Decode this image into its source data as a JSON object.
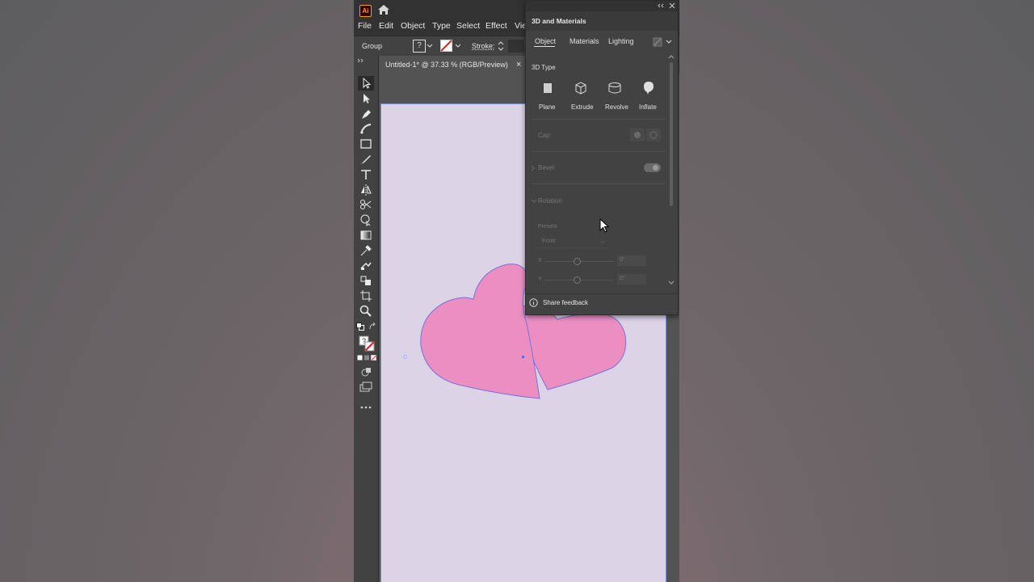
{
  "app": {
    "logo_text": "Ai"
  },
  "menu": [
    "File",
    "Edit",
    "Object",
    "Type",
    "Select",
    "Effect",
    "Vie"
  ],
  "controlbar": {
    "selection_label": "Group",
    "fill_value": "?",
    "stroke_label": "Stroke:"
  },
  "document": {
    "tab_title": "Untitled-1* @ 37.33 % (RGB/Preview)",
    "close_glyph": "×"
  },
  "panel": {
    "title": "3D and Materials",
    "tabs": [
      "Object",
      "Materials",
      "Lighting"
    ],
    "active_tab": "Object",
    "section_3d_type": "3D Type",
    "types": [
      "Plane",
      "Extrude",
      "Revolve",
      "Inflate"
    ],
    "cap_label": "Cap",
    "bevel_label": "Bevel",
    "rotation_label": "Rotation",
    "presets_label": "Presets",
    "preset_value": "Front",
    "x_label": "X",
    "y_label": "Y",
    "x_value": "0°",
    "y_value": "0°",
    "feedback_label": "Share feedback"
  },
  "colors": {
    "heart_fill": "#eb8fc3",
    "heart_stroke": "#7a72d8",
    "artboard": "#ddd3e7",
    "selection": "#4a6ef5"
  }
}
